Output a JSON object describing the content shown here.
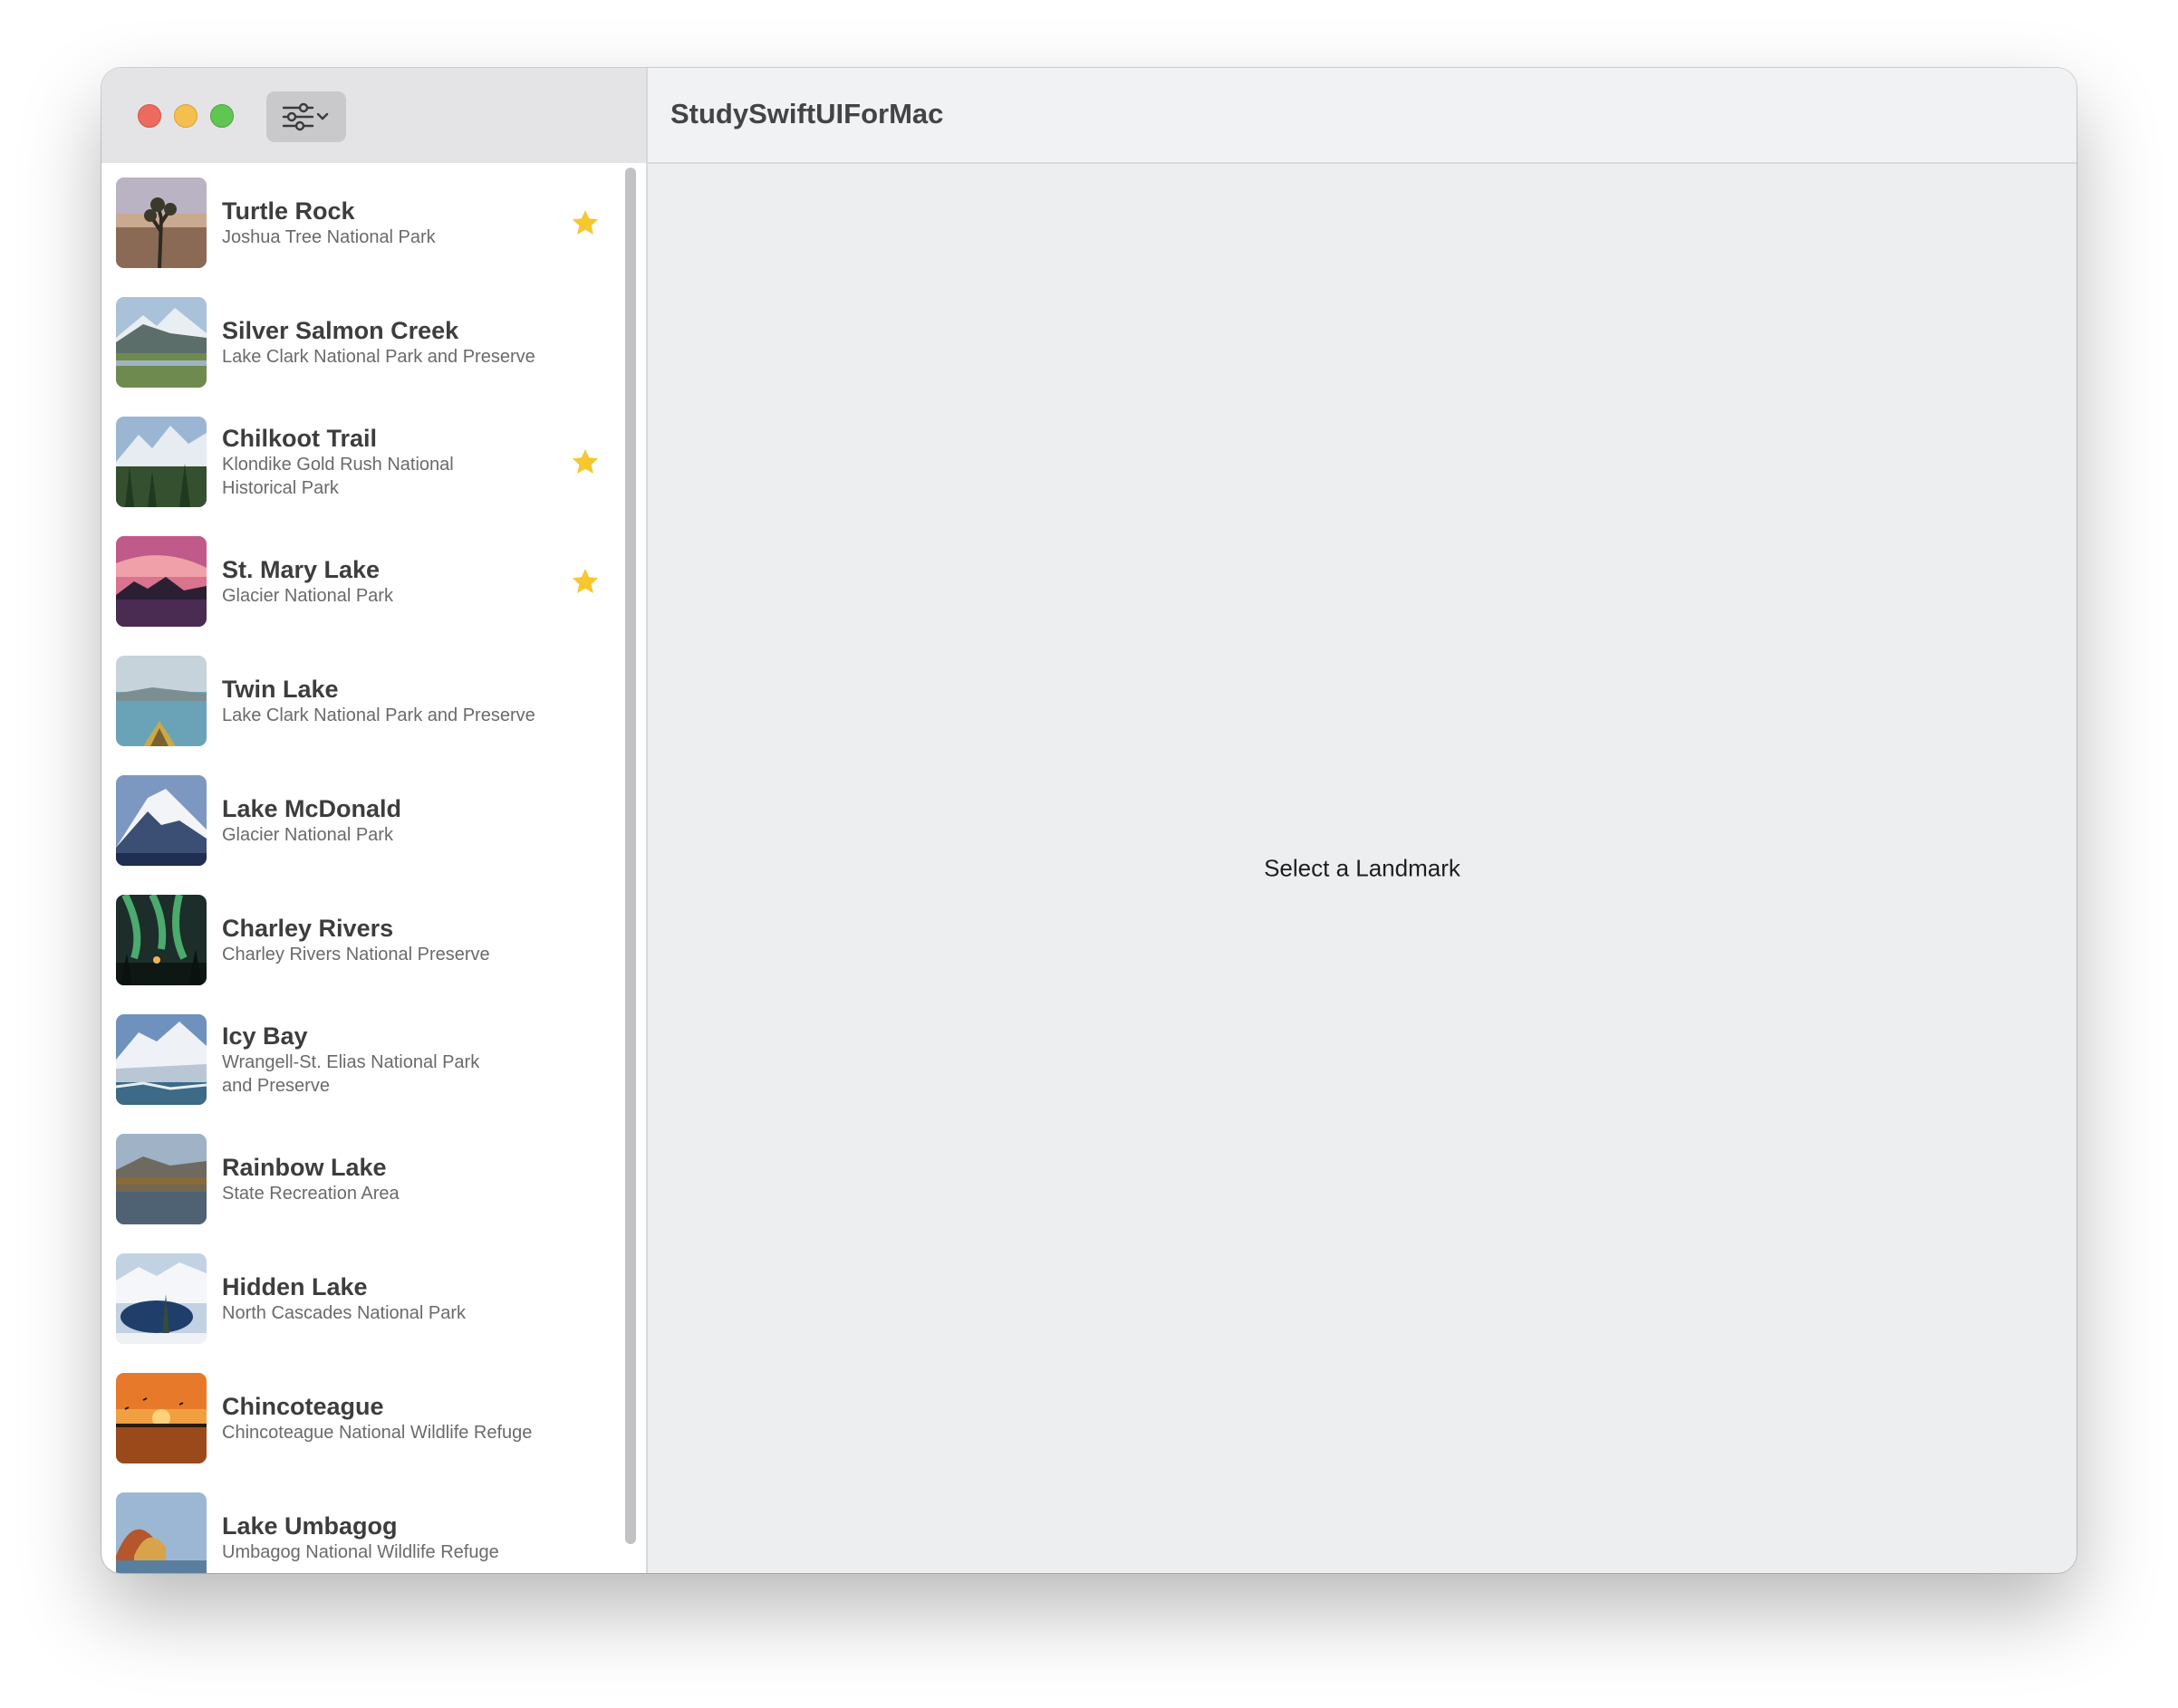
{
  "app": {
    "title": "StudySwiftUIForMac"
  },
  "toolbar": {
    "filter_icon": "filter-sliders-icon"
  },
  "colors": {
    "star": "#f7c730",
    "close": "#ed6a5e",
    "minimize": "#f5bf4f",
    "maximize": "#61c554"
  },
  "landmarks": [
    {
      "name": "Turtle Rock",
      "park": "Joshua Tree National Park",
      "favorite": true
    },
    {
      "name": "Silver Salmon Creek",
      "park": "Lake Clark National Park and Preserve",
      "favorite": false
    },
    {
      "name": "Chilkoot Trail",
      "park": "Klondike Gold Rush National Historical Park",
      "favorite": true
    },
    {
      "name": "St. Mary Lake",
      "park": "Glacier National Park",
      "favorite": true
    },
    {
      "name": "Twin Lake",
      "park": "Lake Clark National Park and Preserve",
      "favorite": false
    },
    {
      "name": "Lake McDonald",
      "park": "Glacier National Park",
      "favorite": false
    },
    {
      "name": "Charley Rivers",
      "park": "Charley Rivers National Preserve",
      "favorite": false
    },
    {
      "name": "Icy Bay",
      "park": "Wrangell-St. Elias National Park and Preserve",
      "favorite": false
    },
    {
      "name": "Rainbow Lake",
      "park": "State Recreation Area",
      "favorite": false
    },
    {
      "name": "Hidden Lake",
      "park": "North Cascades National Park",
      "favorite": false
    },
    {
      "name": "Chincoteague",
      "park": "Chincoteague National Wildlife Refuge",
      "favorite": false
    },
    {
      "name": "Lake Umbagog",
      "park": "Umbagog National Wildlife Refuge",
      "favorite": false
    }
  ],
  "detail": {
    "placeholder": "Select a Landmark"
  }
}
